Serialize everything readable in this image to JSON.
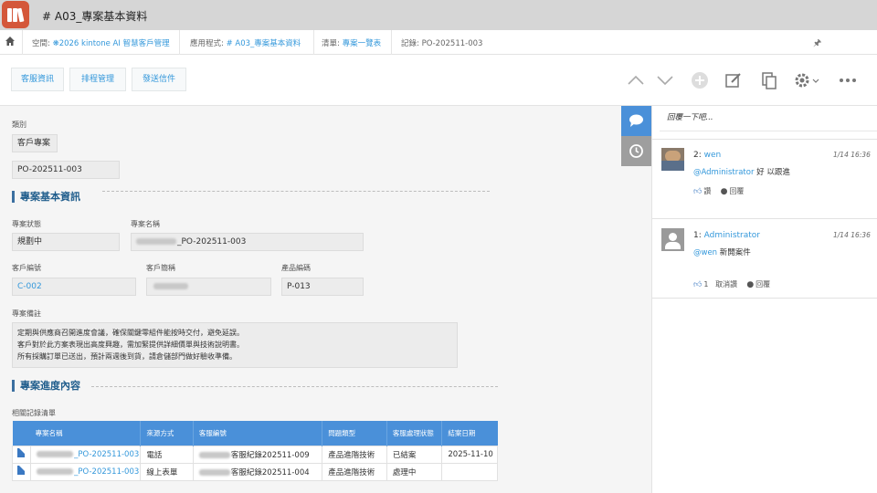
{
  "app": {
    "title": "# A03_專案基本資料"
  },
  "breadcrumb": {
    "space_prefix": "空間: ",
    "space_name": "❋2026 kintone AI 智慧客戶管理",
    "app_prefix": "應用程式: ",
    "app_name": "# A03_專案基本資料",
    "list_prefix": "清單: ",
    "list_name": "專案一覽表",
    "record_label": "記錄: PO-202511-003"
  },
  "toolbar": {
    "buttons": [
      "客服資訊",
      "排程管理",
      "發送信件"
    ],
    "icons": [
      "chevron-up-icon",
      "chevron-down-icon",
      "add-icon",
      "edit-icon",
      "copy-icon",
      "gear-icon",
      "more-icon"
    ]
  },
  "record": {
    "category_label": "類別",
    "category_value": "客戶專案",
    "record_number": "PO-202511-003",
    "group1_title": "專案基本資訊",
    "status_label": "專案狀態",
    "status_value": "規劃中",
    "project_name_label": "專案名稱",
    "project_name_suffix": "_PO-202511-003",
    "customer_id_label": "客戶編號",
    "customer_id_value": "C-002",
    "customer_short_label": "客戶簡稱",
    "product_code_label": "產品編碼",
    "product_code_value": "P-013",
    "notes_label": "專案備註",
    "notes_lines": [
      "定期與供應商召開進度會議，確保關鍵零組件能按時交付，避免延誤。",
      "客戶對於此方案表現出高度興趣，需加緊提供詳細價單與技術說明書。",
      "所有採購訂單已送出，預計兩週後到貨，請倉儲部門做好驗收準備。"
    ],
    "group2_title": "專案進度內容",
    "related_label": "相關記錄清單"
  },
  "related_table": {
    "headers": [
      "專案名稱",
      "來源方式",
      "客服編號",
      "問題類型",
      "客服處理狀態",
      "結案日期"
    ],
    "rows": [
      {
        "project": "_PO-202511-003",
        "source": "電話",
        "ticket": "客服紀錄202511-009",
        "type": "產品進階技術",
        "status": "已結案",
        "closed": "2025-11-10"
      },
      {
        "project": "_PO-202511-003",
        "source": "線上表單",
        "ticket": "客服紀錄202511-004",
        "type": "產品進階技術",
        "status": "處理中",
        "closed": ""
      }
    ]
  },
  "comments": {
    "placeholder": "回覆一下吧...",
    "items": [
      {
        "num": "2:",
        "user": "wen",
        "time": "1/14 16:36",
        "mention": "@Administrator",
        "text": " 好 以跟進",
        "like_label": "讚",
        "reply_label": "回覆"
      },
      {
        "num": "1:",
        "user": "Administrator",
        "time": "1/14 16:36",
        "mention": "@wen",
        "text": " 新開案件",
        "like_count": "1",
        "unlike_label": "取消讚",
        "reply_label": "回覆"
      }
    ]
  },
  "colors": {
    "accent": "#3498db",
    "header_blue": "#4a90d9",
    "app_icon": "#d4573a",
    "group_title": "#1f5d8c"
  }
}
